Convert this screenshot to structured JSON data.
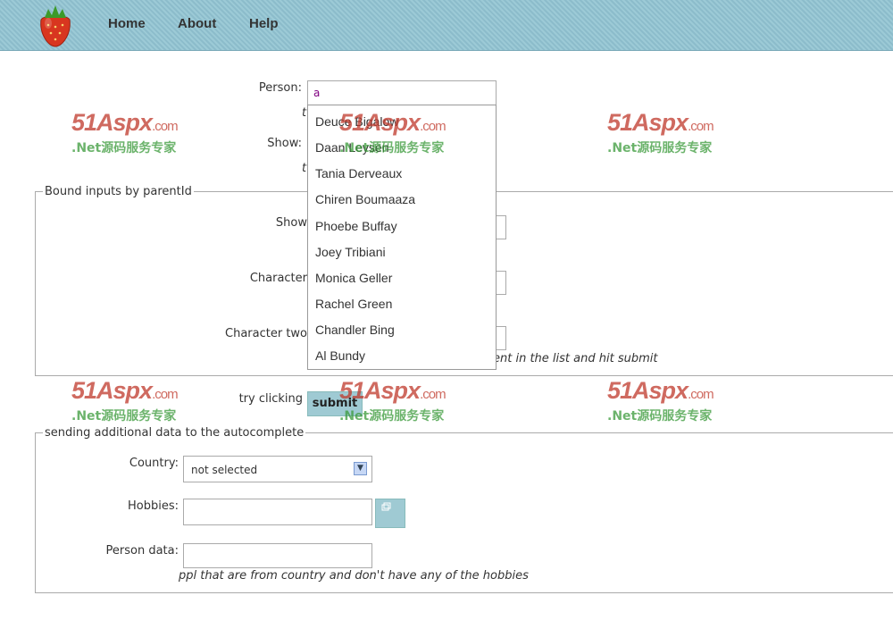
{
  "nav": {
    "home": "Home",
    "about": "About",
    "help": "Help"
  },
  "form": {
    "person_label": "Person:",
    "person_value": "a",
    "person_hint_frag": "t",
    "show_label": "Show:",
    "show_hint_frag": "t"
  },
  "bound": {
    "legend": "Bound inputs by parentId",
    "show_label": "Show",
    "character_label": "Character",
    "character_two_label": "Character two",
    "hint": "ent in the list and hit submit"
  },
  "submit": {
    "prompt": "try clicking",
    "button": "submit"
  },
  "additional": {
    "legend": "sending additional data to the autocomplete",
    "country_label": "Country:",
    "country_value": "not selected",
    "hobbies_label": "Hobbies:",
    "person_data_label": "Person data:",
    "hint": "ppl that are from country and don't have any of the hobbies"
  },
  "dropdown": [
    "Deuce Bigalow",
    "Daan Leysen",
    "Tania Derveaux",
    "Chiren Boumaaza",
    "Phoebe Buffay",
    "Joey Tribiani",
    "Monica Geller",
    "Rachel Green",
    "Chandler Bing",
    "Al Bundy"
  ],
  "watermark": {
    "brand": "51Aspx",
    "tld": ".com",
    "tagline": ".Net源码服务专家"
  },
  "colors": {
    "header": "#9ccad6",
    "button": "#9fcad3",
    "wm_red": "#c0392b",
    "wm_green": "#3a9a3a"
  }
}
